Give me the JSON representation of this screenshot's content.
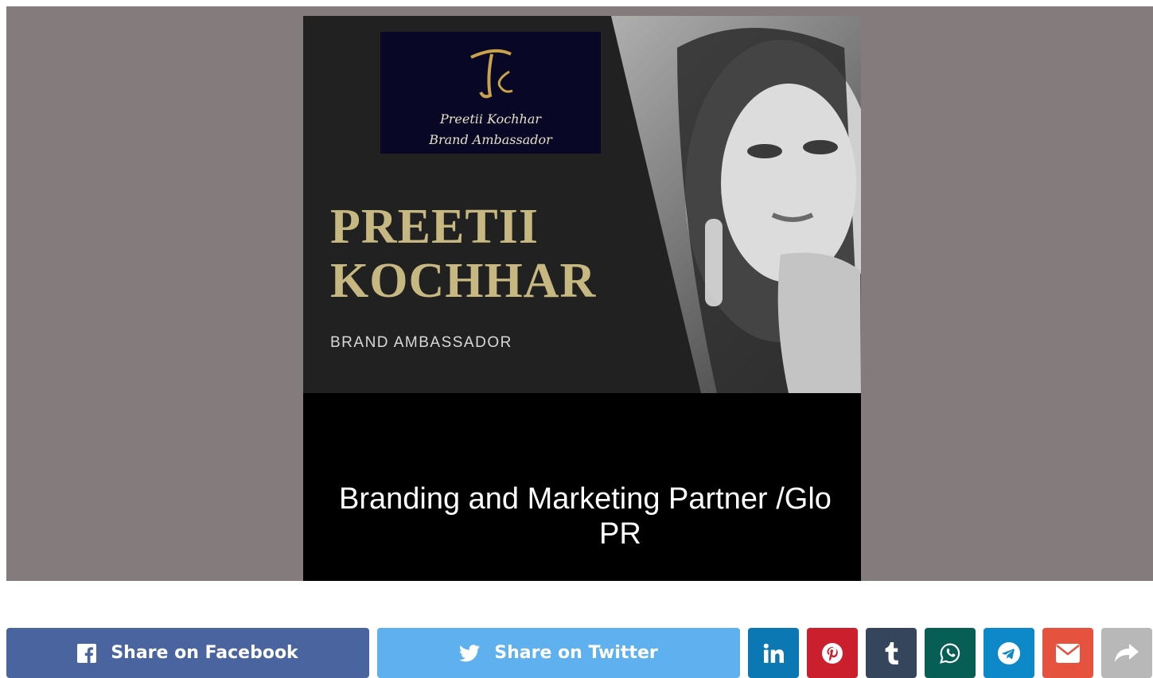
{
  "poster": {
    "logo_line1": "Preetii Kochhar",
    "logo_line2": "Brand Ambassador",
    "name_line1": "PREETII",
    "name_line2": "KOCHHAR",
    "role": "BRAND AMBASSADOR",
    "caption_line1": "Branding and Marketing Partner /Glo",
    "caption_line2": "PR"
  },
  "share": {
    "facebook_label": "Share on Facebook",
    "twitter_label": "Share on Twitter",
    "icons": [
      "facebook-icon",
      "twitter-icon",
      "linkedin-icon",
      "pinterest-icon",
      "tumblr-icon",
      "whatsapp-icon",
      "telegram-icon",
      "email-icon",
      "share-icon"
    ],
    "colors": {
      "facebook": "#4a64a0",
      "twitter": "#5fb0ef",
      "linkedin": "#0b78b4",
      "pinterest": "#cc1f2d",
      "tumblr": "#35465c",
      "whatsapp": "#075e54",
      "telegram": "#0d89c9",
      "email": "#e5533e",
      "more": "#b8b8b8"
    }
  }
}
